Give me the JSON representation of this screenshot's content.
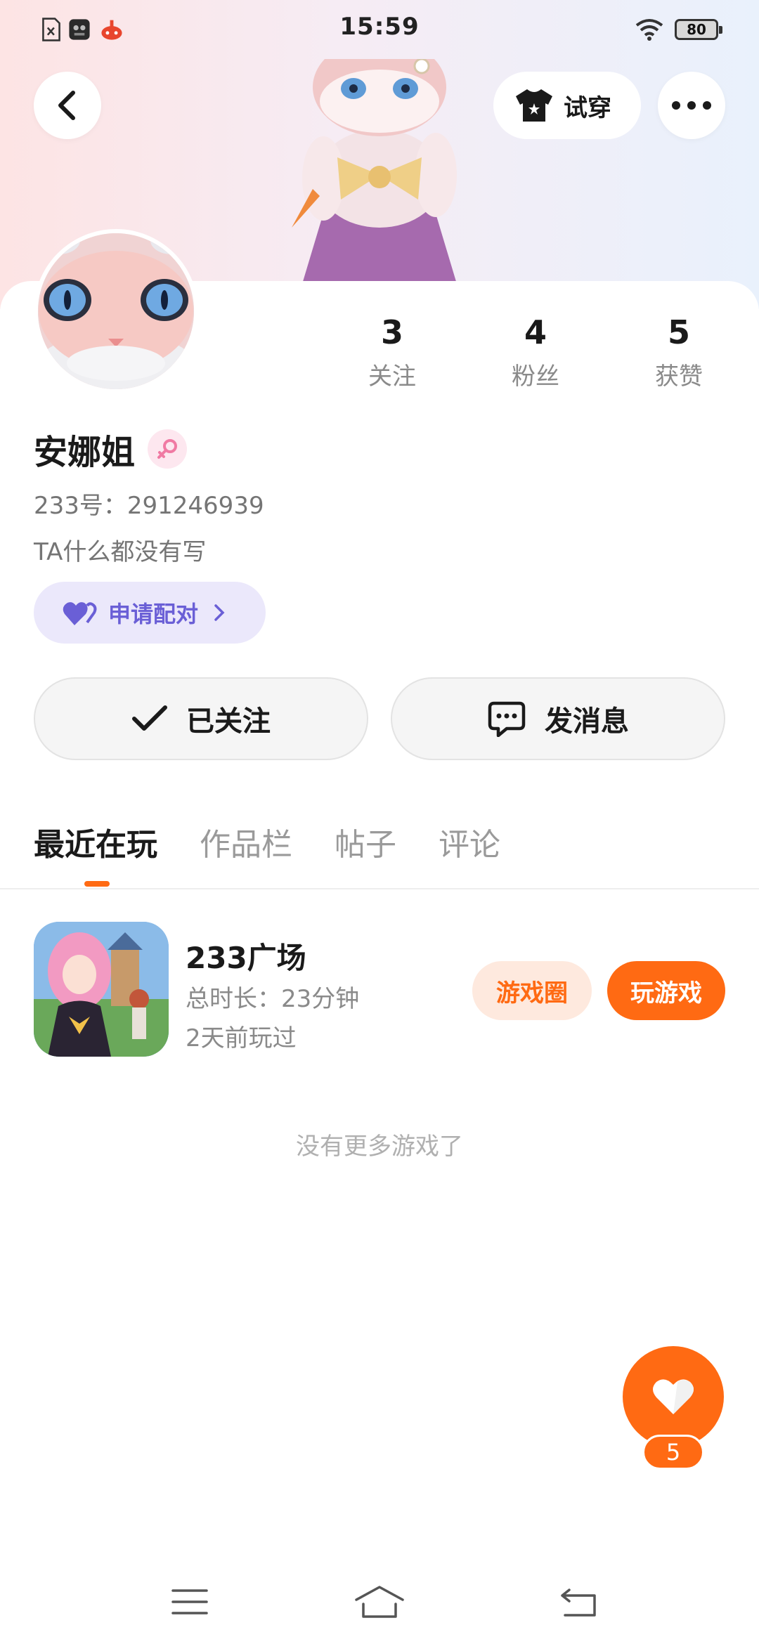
{
  "status_bar": {
    "time": "15:59",
    "battery": "80",
    "left_icons": [
      "sim-icon",
      "app-notification-icon",
      "game-notification-icon"
    ],
    "right_icons": [
      "wifi-icon",
      "battery-icon"
    ]
  },
  "header": {
    "tryon_label": "试穿",
    "icons": [
      "back-icon",
      "shirt-icon",
      "more-icon"
    ]
  },
  "profile": {
    "stats": [
      {
        "count": "3",
        "label": "关注"
      },
      {
        "count": "4",
        "label": "粉丝"
      },
      {
        "count": "5",
        "label": "获赞"
      }
    ],
    "nickname": "安娜姐",
    "gender": "female",
    "uid": "233号：291246939",
    "bio": "TA什么都没有写",
    "match_label": "申请配对"
  },
  "actions": {
    "follow_label": "已关注",
    "message_label": "发消息"
  },
  "tabs": [
    {
      "label": "最近在玩",
      "active": true
    },
    {
      "label": "作品栏",
      "active": false
    },
    {
      "label": "帖子",
      "active": false
    },
    {
      "label": "评论",
      "active": false
    }
  ],
  "games": [
    {
      "name": "233广场",
      "duration": "总时长：23分钟",
      "last_played": "2天前玩过",
      "circle_label": "游戏圈",
      "play_label": "玩游戏"
    }
  ],
  "empty_text": "没有更多游戏了",
  "like": {
    "count": "5"
  },
  "colors": {
    "accent": "#ff6a13",
    "match_text": "#6a5fd6",
    "match_bg": "#ebe8fb",
    "secondary_text": "#8a8a8a"
  }
}
